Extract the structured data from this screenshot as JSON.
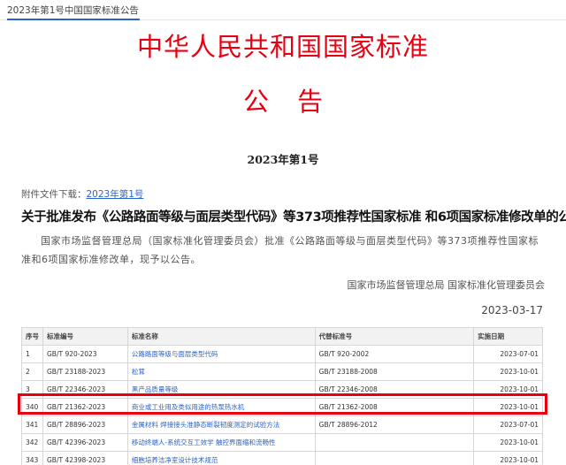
{
  "breadcrumb": "2023年第1号中国国家标准公告",
  "title_main": "中华人民共和国国家标准",
  "title_sub": "公告",
  "issue_number": "2023年第1号",
  "attachment": {
    "label": "附件文件下载：",
    "link_text": "2023年第1号"
  },
  "headline": "关于批准发布《公路路面等级与面层类型代码》等373项推荐性国家标准 和6项国家标准修改单的公告",
  "body": "国家市场监督管理总局（国家标准化管理委员会）批准《公路路面等级与面层类型代码》等373项推荐性国家标准和6项国家标准修改单，现予以公告。",
  "signature": "国家市场监督管理总局 国家标准化管理委员会",
  "date": "2023-03-17",
  "table": {
    "headers": [
      "序号",
      "标准编号",
      "标准名称",
      "代替标准号",
      "实施日期"
    ],
    "rows": [
      {
        "no": "1",
        "code": "GB/T 920-2023",
        "name": "公路路面等级与面层类型代码",
        "replaces": "GB/T 920-2002",
        "date": "2023-07-01"
      },
      {
        "no": "2",
        "code": "GB/T 23188-2023",
        "name": "松茸",
        "replaces": "GB/T 23188-2008",
        "date": "2023-10-01"
      },
      {
        "no": "3",
        "code": "GB/T 22346-2023",
        "name": "黑产品质量等级",
        "replaces": "GB/T 22346-2008",
        "date": "2023-10-01"
      },
      {
        "no": "340",
        "code": "GB/T 21362-2023",
        "name": "商业或工业用及类似用途的热泵热水机",
        "replaces": "GB/T 21362-2008",
        "date": "2023-10-01"
      },
      {
        "no": "341",
        "code": "GB/T 28896-2023",
        "name": "金属材料 焊接接头准静态断裂韧度测定的试验方法",
        "replaces": "GB/T 28896-2012",
        "date": "2023-07-01"
      },
      {
        "no": "342",
        "code": "GB/T 42396-2023",
        "name": "移动终端人-系统交互工效学 触控界面缩和流畅性",
        "replaces": "",
        "date": "2023-10-01"
      },
      {
        "no": "343",
        "code": "GB/T 42398-2023",
        "name": "细胞培养洁净室设计技术规范",
        "replaces": "",
        "date": "2023-10-01"
      }
    ]
  }
}
